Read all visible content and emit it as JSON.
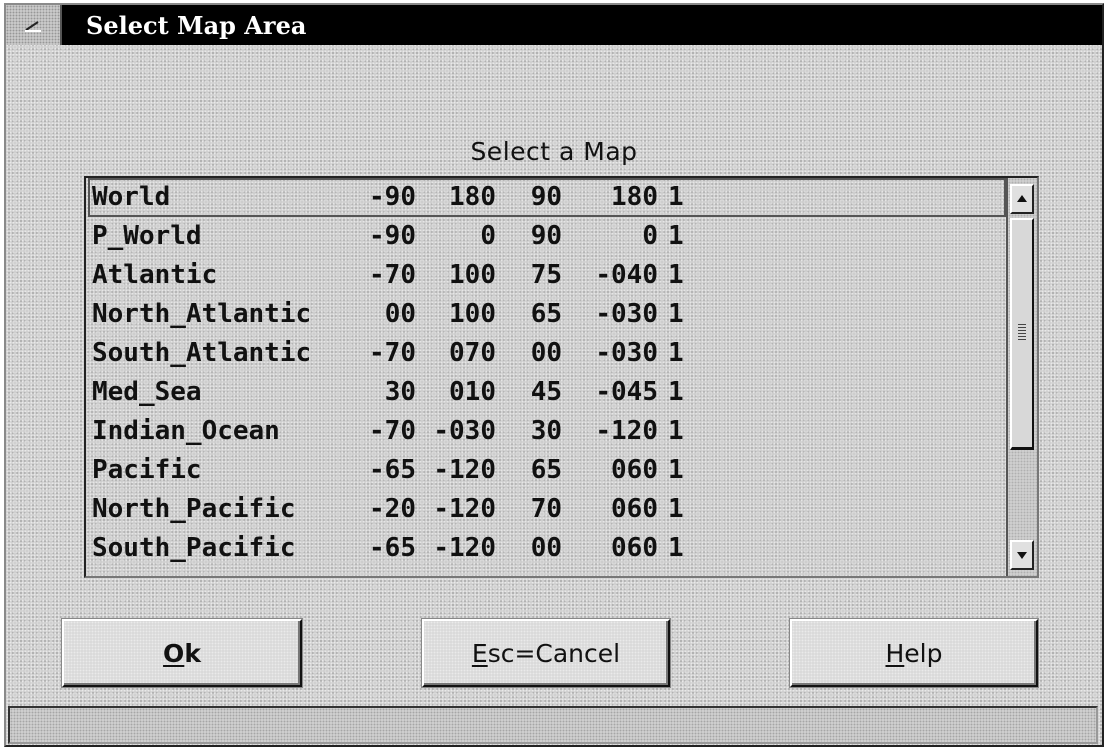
{
  "window": {
    "title": "Select Map Area",
    "system_menu_icon": "window-menu-icon"
  },
  "list": {
    "caption": "Select a Map",
    "rows": [
      {
        "name": "World",
        "a": "-90",
        "b": "180",
        "c": "90",
        "d": "180",
        "e": "1",
        "selected": true
      },
      {
        "name": "P_World",
        "a": "-90",
        "b": "0",
        "c": "90",
        "d": "0",
        "e": "1"
      },
      {
        "name": "Atlantic",
        "a": "-70",
        "b": "100",
        "c": "75",
        "d": "-040",
        "e": "1"
      },
      {
        "name": "North_Atlantic",
        "a": "00",
        "b": "100",
        "c": "65",
        "d": "-030",
        "e": "1"
      },
      {
        "name": "South_Atlantic",
        "a": "-70",
        "b": "070",
        "c": "00",
        "d": "-030",
        "e": "1"
      },
      {
        "name": "Med_Sea",
        "a": "30",
        "b": "010",
        "c": "45",
        "d": "-045",
        "e": "1"
      },
      {
        "name": "Indian_Ocean",
        "a": "-70",
        "b": "-030",
        "c": "30",
        "d": "-120",
        "e": "1"
      },
      {
        "name": "Pacific",
        "a": "-65",
        "b": "-120",
        "c": "65",
        "d": "060",
        "e": "1"
      },
      {
        "name": "North_Pacific",
        "a": "-20",
        "b": "-120",
        "c": "70",
        "d": "060",
        "e": "1"
      },
      {
        "name": "South_Pacific",
        "a": "-65",
        "b": "-120",
        "c": "00",
        "d": "060",
        "e": "1"
      }
    ],
    "scroll_up_icon": "arrow-up-icon",
    "scroll_down_icon": "arrow-down-icon"
  },
  "buttons": {
    "ok": {
      "mnemonic": "O",
      "rest": "k"
    },
    "cancel": {
      "mnemonic": "E",
      "rest": "sc=Cancel"
    },
    "help": {
      "mnemonic": "H",
      "rest": "elp"
    }
  },
  "status_bar": {
    "text": ""
  }
}
